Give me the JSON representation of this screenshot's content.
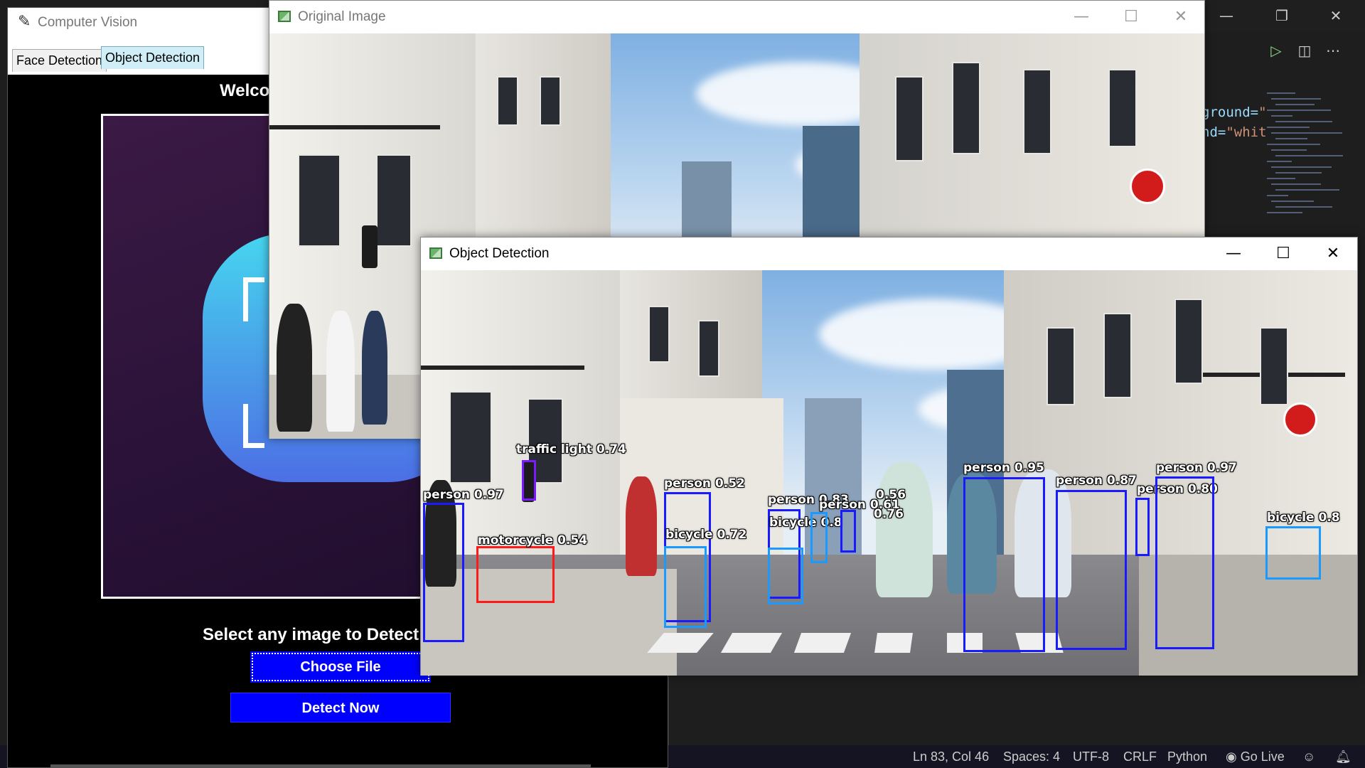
{
  "vscode": {
    "code_lines": [
      {
        "prefix": "ground=",
        "value": "\"w"
      },
      {
        "prefix": "nd=",
        "value": "\"whit"
      }
    ],
    "status": {
      "position": "Ln 83, Col 46",
      "spaces": "Spaces: 4",
      "encoding": "UTF-8",
      "eol": "CRLF",
      "language": "Python",
      "go_live": "Go Live"
    },
    "window_buttons": [
      "minimize-icon",
      "restore-icon",
      "close-icon"
    ],
    "editor_actions": [
      "run-icon",
      "split-editor-icon",
      "more-actions-icon"
    ]
  },
  "tk_app": {
    "title": "Computer Vision",
    "tabs": [
      {
        "label": "Face Detection",
        "active": false
      },
      {
        "label": "Object Detection",
        "active": true
      }
    ],
    "welcome": "Welco",
    "select_label": "Select any image to Detect",
    "choose_button": "Choose File",
    "detect_button": "Detect Now"
  },
  "original_window": {
    "title": "Original Image"
  },
  "detection_window": {
    "title": "Object Detection",
    "detections": [
      {
        "label": "traffic light 0.74",
        "color": "#7a1aff"
      },
      {
        "label": "person 0.97",
        "color": "#1a1aff"
      },
      {
        "label": "motorcycle 0.54",
        "color": "#ff1a1a"
      },
      {
        "label": "person 0.52",
        "color": "#1a1aff"
      },
      {
        "label": "bicycle 0.72",
        "color": "#1a9aff"
      },
      {
        "label": "person 0.83",
        "color": "#1a1aff"
      },
      {
        "label": "bicycle 0.8",
        "color": "#1a9aff"
      },
      {
        "label": "person 0.61",
        "color": "#1a1aff"
      },
      {
        "label": "0.56",
        "color": "#1a1aff"
      },
      {
        "label": "0.76",
        "color": "#1a1aff"
      },
      {
        "label": "person 0.95",
        "color": "#1a1aff"
      },
      {
        "label": "person 0.87",
        "color": "#1a1aff"
      },
      {
        "label": "person 0.80",
        "color": "#1a1aff"
      },
      {
        "label": "person 0.97",
        "color": "#1a1aff"
      },
      {
        "label": "bicycle 0.8",
        "color": "#1a9aff"
      }
    ]
  }
}
